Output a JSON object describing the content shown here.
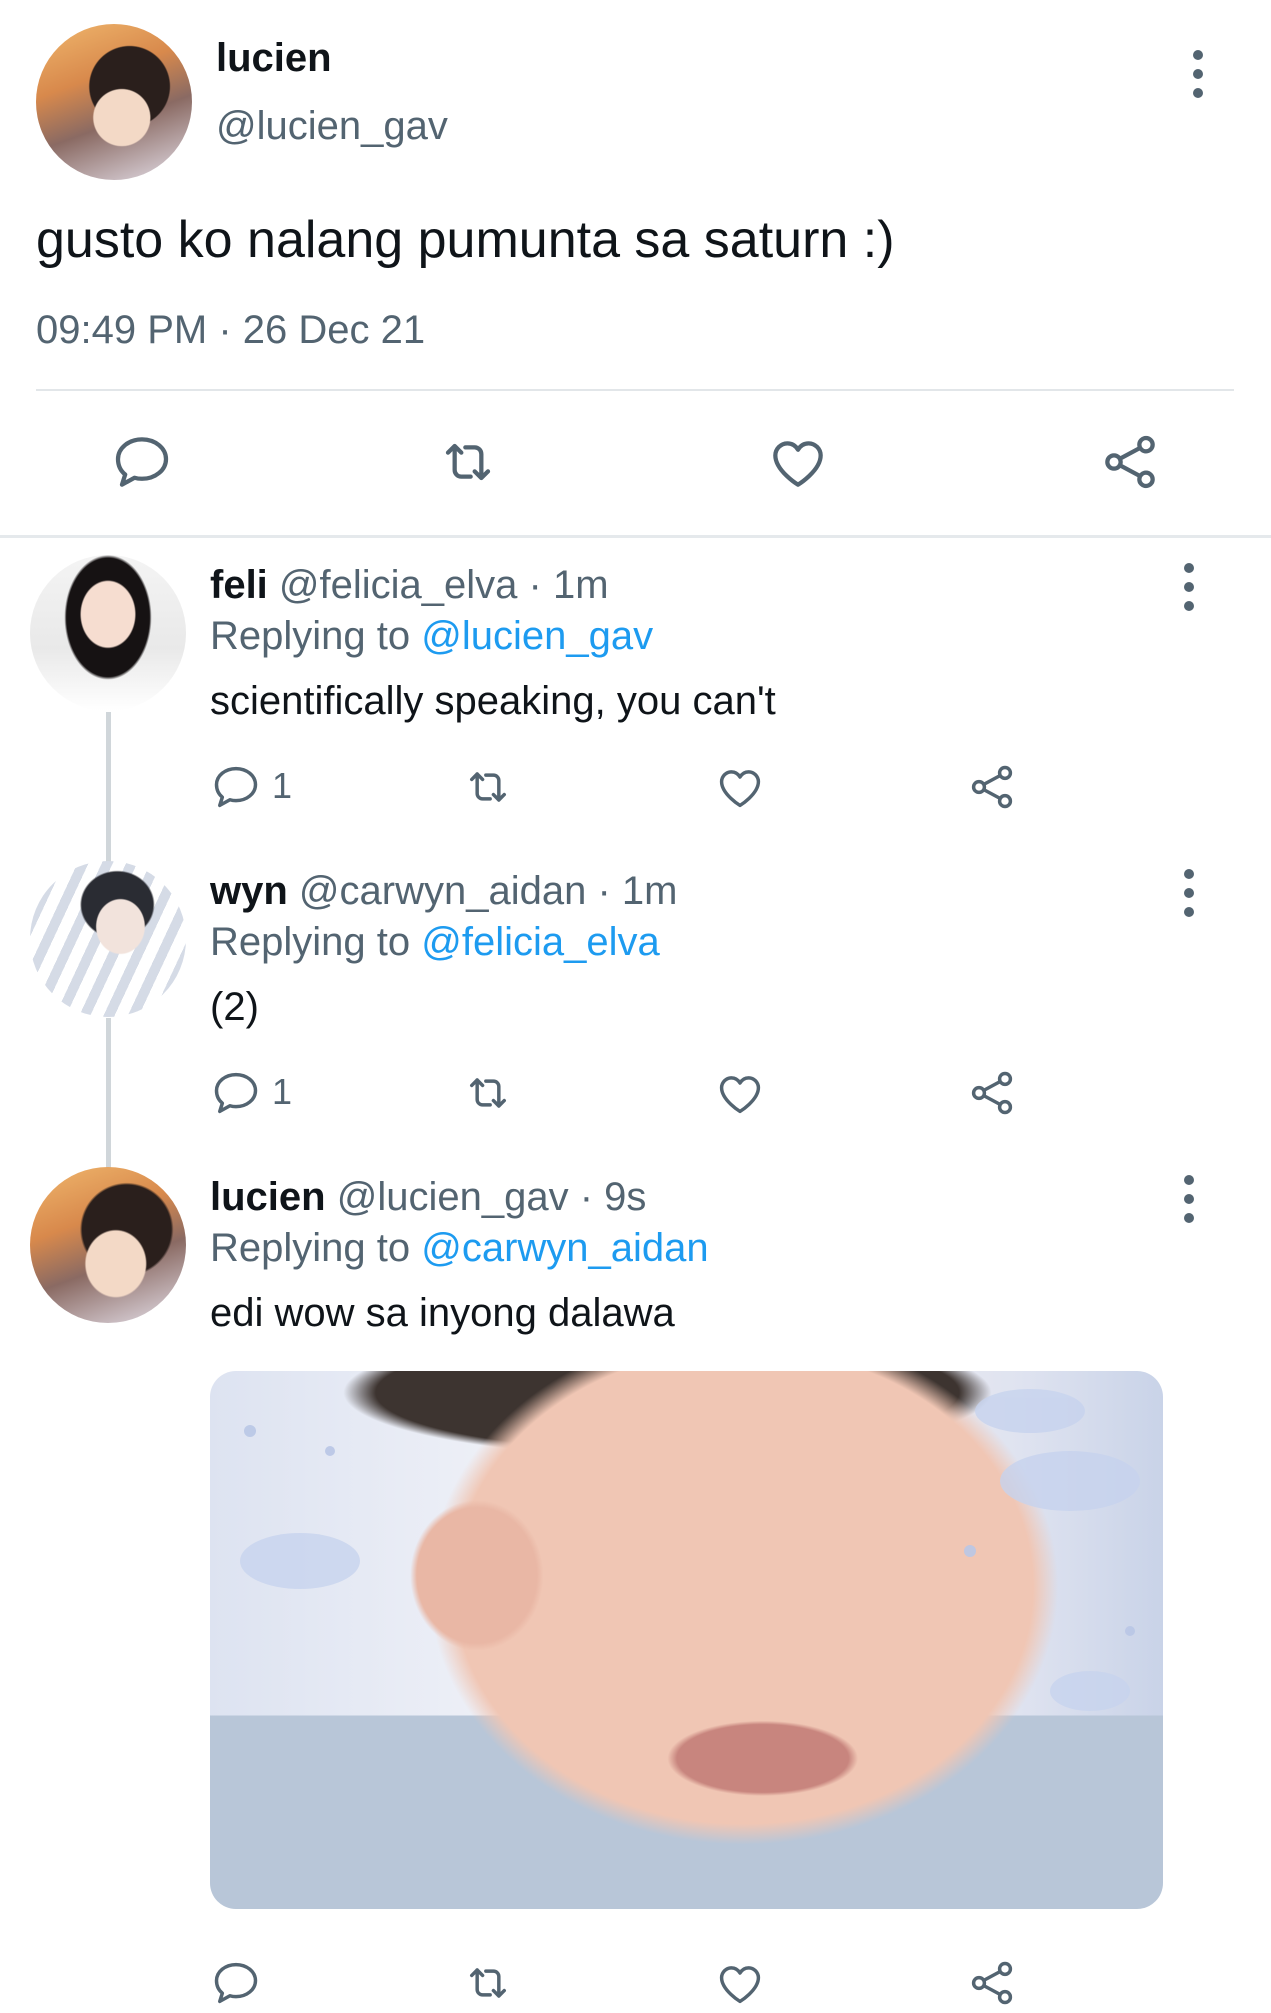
{
  "main_tweet": {
    "name": "lucien",
    "handle": "@lucien_gav",
    "text": "gusto ko nalang pumunta sa saturn :)",
    "timestamp": "09:49 PM · 26 Dec 21",
    "actions": [
      "reply-icon",
      "retweet-icon",
      "like-icon",
      "share-icon"
    ]
  },
  "replies": [
    {
      "name": "feli",
      "meta": "@felicia_elva · 1m",
      "replying_label": "Replying to",
      "replying_to": "@lucien_gav",
      "text": "scientifically speaking, you can't",
      "reply_count": "1"
    },
    {
      "name": "wyn",
      "meta": "@carwyn_aidan · 1m",
      "replying_label": "Replying to",
      "replying_to": "@felicia_elva",
      "text": "(2)",
      "reply_count": "1"
    },
    {
      "name": "lucien",
      "meta": "@lucien_gav · 9s",
      "replying_label": "Replying to",
      "replying_to": "@carwyn_aidan",
      "text": "edi wow sa inyong dalawa",
      "reply_count": "",
      "has_media": true
    }
  ],
  "colors": {
    "text_primary": "#0f1419",
    "text_secondary": "#536471",
    "link": "#1d9bf0",
    "divider": "#e2e6e9"
  }
}
